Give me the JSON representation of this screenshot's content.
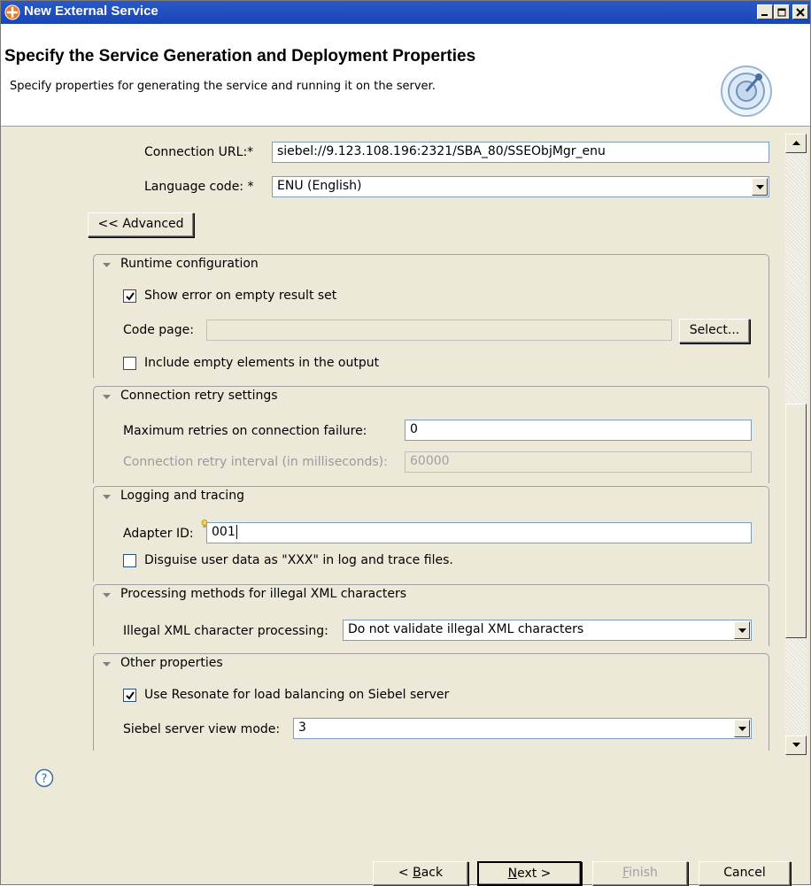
{
  "window": {
    "title": "New External Service"
  },
  "header": {
    "heading": "Specify the Service Generation and Deployment Properties",
    "description": "Specify properties for generating the service and running it on the server."
  },
  "connection": {
    "url_label": "Connection URL:*",
    "url_value": "siebel://9.123.108.196:2321/SBA_80/SSEObjMgr_enu",
    "language_label": "Language code: *",
    "language_value": "ENU (English)"
  },
  "advanced_button": "<< Advanced",
  "runtime": {
    "title": "Runtime configuration",
    "show_error_label": "Show error on empty result set",
    "show_error_checked": true,
    "code_page_label": "Code page:",
    "code_page_value": "",
    "select_button": "Select...",
    "include_empty_label": "Include empty elements in the output",
    "include_empty_checked": false
  },
  "retry": {
    "title": "Connection retry settings",
    "max_retries_label": "Maximum retries on connection failure:",
    "max_retries_value": "0",
    "interval_label": "Connection retry interval (in milliseconds):",
    "interval_value": "60000"
  },
  "logging": {
    "title": "Logging and tracing",
    "adapter_id_label": "Adapter ID:",
    "adapter_id_value": "001",
    "disguise_label": "Disguise user data as \"XXX\" in log and trace files.",
    "disguise_checked": false
  },
  "illegal_xml": {
    "title": "Processing methods for illegal XML characters",
    "processing_label": "Illegal XML character processing:",
    "processing_value": "Do not validate illegal XML characters"
  },
  "other": {
    "title": "Other properties",
    "resonate_label": "Use Resonate for load balancing on Siebel server",
    "resonate_checked": true,
    "view_mode_label": "Siebel server view mode:",
    "view_mode_value": "3"
  },
  "footer": {
    "back": {
      "pre": "< ",
      "key": "B",
      "post": "ack"
    },
    "next": {
      "key": "N",
      "post": "ext >"
    },
    "finish": {
      "key": "F",
      "post": "inish"
    },
    "cancel": "Cancel"
  },
  "icons": [
    "app-icon",
    "minimize-icon",
    "maximize-icon",
    "close-icon",
    "wizard-banner-icon",
    "dropdown-arrow-icon",
    "checkmark-icon",
    "twisty-expanded-icon",
    "scroll-up-icon",
    "scroll-down-icon",
    "help-icon",
    "lightbulb-icon"
  ],
  "colors": {
    "titlebar": "#2a58c7",
    "dialog_bg": "#ece9d8",
    "field_border": "#7f9db9"
  }
}
